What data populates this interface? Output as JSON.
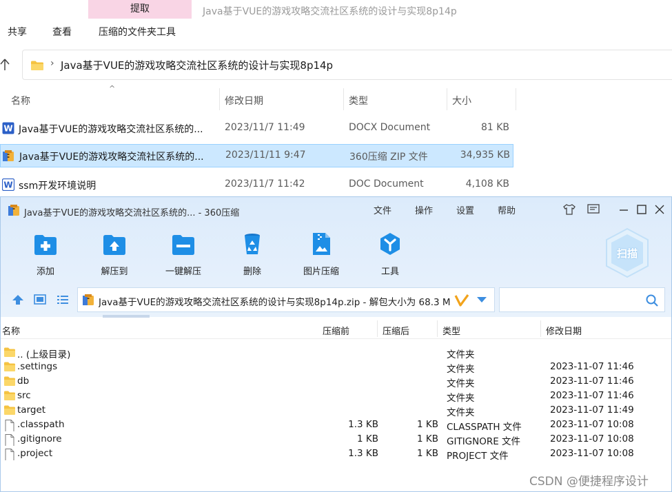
{
  "explorer": {
    "extract_tab": "提取",
    "window_title": "Java基于VUE的游戏攻略交流社区系统的设计与实现8p14p",
    "ribbon": [
      "共享",
      "查看",
      "压缩的文件夹工具"
    ],
    "address": "Java基于VUE的游戏攻略交流社区系统的设计与实现8p14p",
    "columns": {
      "name": "名称",
      "modified": "修改日期",
      "type": "类型",
      "size": "大小"
    },
    "files": [
      {
        "name": "Java基于VUE的游戏攻略交流社区系统的...",
        "modified": "2023/11/7 11:49",
        "type": "DOCX Document",
        "size": "81 KB",
        "icon": "word-doc-icon"
      },
      {
        "name": "Java基于VUE的游戏攻略交流社区系统的...",
        "modified": "2023/11/11 9:47",
        "type": "360压缩 ZIP 文件",
        "size": "34,935 KB",
        "icon": "zip-archive-icon"
      },
      {
        "name": "ssm开发环境说明",
        "modified": "2023/11/7 11:42",
        "type": "DOC Document",
        "size": "4,108 KB",
        "icon": "word-doc-icon"
      }
    ]
  },
  "zip_window": {
    "title": "Java基于VUE的游戏攻略交流社区系统的... - 360压缩",
    "menu": [
      "文件",
      "操作",
      "设置",
      "帮助"
    ],
    "toolbar": [
      {
        "label": "添加",
        "icon": "add-icon"
      },
      {
        "label": "解压到",
        "icon": "extract-to-icon"
      },
      {
        "label": "一键解压",
        "icon": "one-click-extract-icon"
      },
      {
        "label": "删除",
        "icon": "recycle-bin-icon"
      },
      {
        "label": "图片压缩",
        "icon": "image-compress-icon"
      },
      {
        "label": "工具",
        "icon": "tools-icon"
      }
    ],
    "scan_label": "扫描",
    "path": "Java基于VUE的游戏攻略交流社区系统的设计与实现8p14p.zip - 解包大小为 68.3 M",
    "columns": {
      "name": "名称",
      "before": "压缩前",
      "after": "压缩后",
      "type": "类型",
      "modified": "修改日期"
    },
    "entries": [
      {
        "name": ".. (上级目录)",
        "before": "",
        "after": "",
        "type": "文件夹",
        "modified": "",
        "kind": "folder"
      },
      {
        "name": ".settings",
        "before": "",
        "after": "",
        "type": "文件夹",
        "modified": "2023-11-07 11:46",
        "kind": "folder"
      },
      {
        "name": "db",
        "before": "",
        "after": "",
        "type": "文件夹",
        "modified": "2023-11-07 11:46",
        "kind": "folder"
      },
      {
        "name": "src",
        "before": "",
        "after": "",
        "type": "文件夹",
        "modified": "2023-11-07 11:46",
        "kind": "folder"
      },
      {
        "name": "target",
        "before": "",
        "after": "",
        "type": "文件夹",
        "modified": "2023-11-07 11:49",
        "kind": "folder"
      },
      {
        "name": ".classpath",
        "before": "1.3 KB",
        "after": "1 KB",
        "type": "CLASSPATH 文件",
        "modified": "2023-11-07 10:08",
        "kind": "file"
      },
      {
        "name": ".gitignore",
        "before": "1 KB",
        "after": "1 KB",
        "type": "GITIGNORE 文件",
        "modified": "2023-11-07 10:08",
        "kind": "file"
      },
      {
        "name": ".project",
        "before": "1.3 KB",
        "after": "1 KB",
        "type": "PROJECT 文件",
        "modified": "2023-11-07 10:08",
        "kind": "file"
      }
    ]
  },
  "watermark": "CSDN @便捷程序设计",
  "colors": {
    "selection": "#cce8ff",
    "accent_blue": "#1f8ce6",
    "folder_yellow": "#f5c342",
    "extract_tab_pink": "#f9d5e5"
  }
}
